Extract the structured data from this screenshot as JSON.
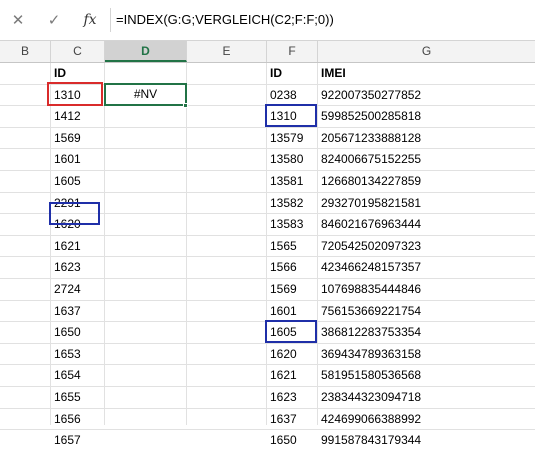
{
  "formula_bar": {
    "cancel_icon": "close-icon",
    "enter_icon": "checkmark-icon",
    "fx_label": "fx",
    "formula": "=INDEX(G:G;VERGLEICH(C2;F:F;0))"
  },
  "columns": {
    "B": "B",
    "C": "C",
    "D": "D",
    "E": "E",
    "F": "F",
    "G": "G",
    "active": "D"
  },
  "sheet": {
    "c_header": "ID",
    "d_value": "#NV",
    "f_header": "ID",
    "g_header": "IMEI",
    "c_values": [
      "1310",
      "1412",
      "1569",
      "1601",
      "1605",
      "2291",
      "1620",
      "1621",
      "1623",
      "2724",
      "1637",
      "1650",
      "1653",
      "1654",
      "1655",
      "1656",
      "1657"
    ],
    "f_values": [
      "0238",
      "1310",
      "13579",
      "13580",
      "13581",
      "13582",
      "13583",
      "1565",
      "1566",
      "1569",
      "1601",
      "1605",
      "1620",
      "1621",
      "1623",
      "1637",
      "1650"
    ],
    "g_values": [
      "922007350277852",
      "599852500285818",
      "205671233888128",
      "824006675152255",
      "126680134227859",
      "293270195821581",
      "846021676963444",
      "720542502097323",
      "423466248157357",
      "107698835444846",
      "756153669221754",
      "386812283753354",
      "369434789363158",
      "581951580536568",
      "238344323094718",
      "424699066388992",
      "991587843179344"
    ]
  },
  "highlights": {
    "red_color": "#d92b2b",
    "blue_color": "#1f2fa8",
    "selection_color": "#217346"
  }
}
